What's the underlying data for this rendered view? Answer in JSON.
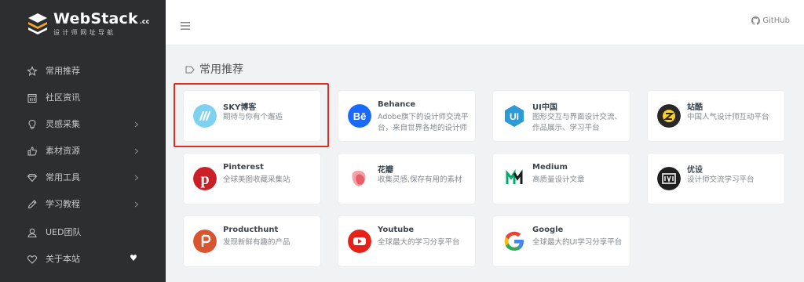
{
  "brand": {
    "title": "WebStack",
    "tld": ".cc",
    "subtitle": "设计师网址导航"
  },
  "sidebar": {
    "items": [
      {
        "label": "常用推荐",
        "icon": "star-icon",
        "arrow": false,
        "heart": false
      },
      {
        "label": "社区资讯",
        "icon": "calendar-icon",
        "arrow": false,
        "heart": false
      },
      {
        "label": "灵感采集",
        "icon": "lightbulb-icon",
        "arrow": true,
        "heart": false
      },
      {
        "label": "素材资源",
        "icon": "thumbs-up-icon",
        "arrow": true,
        "heart": false
      },
      {
        "label": "常用工具",
        "icon": "diamond-icon",
        "arrow": true,
        "heart": false
      },
      {
        "label": "学习教程",
        "icon": "pencil-icon",
        "arrow": true,
        "heart": false
      },
      {
        "label": "UED团队",
        "icon": "user-icon",
        "arrow": false,
        "heart": false
      },
      {
        "label": "关于本站",
        "icon": "heart-outline-icon",
        "arrow": false,
        "heart": true
      }
    ],
    "heart_glyph": "♥"
  },
  "topbar": {
    "github_label": "GitHub"
  },
  "section": {
    "title": "常用推荐"
  },
  "cards": [
    {
      "title": "SKY博客",
      "desc": "期待与你有个邂逅",
      "icon": "sky-blog-logo-icon",
      "lines": 1
    },
    {
      "title": "Behance",
      "desc": "Adobe旗下的设计师交流平台，来自世界各地的设计师在这里分享自己的作品",
      "icon": "behance-logo-icon",
      "lines": 2
    },
    {
      "title": "UI中国",
      "desc": "图形交互与界面设计交流、作品展示、学习平台",
      "icon": "ui-china-logo-icon",
      "lines": 2
    },
    {
      "title": "站酷",
      "desc": "中国人气设计师互动平台",
      "icon": "zcool-logo-icon",
      "lines": 1
    },
    {
      "title": "Pinterest",
      "desc": "全球美图收藏采集站",
      "icon": "pinterest-logo-icon",
      "lines": 1
    },
    {
      "title": "花瓣",
      "desc": "收集灵感,保存有用的素材",
      "icon": "huaban-logo-icon",
      "lines": 1
    },
    {
      "title": "Medium",
      "desc": "高质量设计文章",
      "icon": "medium-logo-icon",
      "lines": 1
    },
    {
      "title": "优设",
      "desc": "设计师交流学习平台",
      "icon": "uisdc-logo-icon",
      "lines": 1
    },
    {
      "title": "Producthunt",
      "desc": "发现新鲜有趣的产品",
      "icon": "producthunt-logo-icon",
      "lines": 1
    },
    {
      "title": "Youtube",
      "desc": "全球最大的学习分享平台",
      "icon": "youtube-logo-icon",
      "lines": 1
    },
    {
      "title": "Google",
      "desc": "全球最大的UI学习分享平台",
      "icon": "google-logo-icon",
      "lines": 2
    }
  ],
  "colors": {
    "sidebar_bg": "#2c2e2f",
    "page_bg": "#f1f2f4",
    "highlight": "#e12b22"
  }
}
